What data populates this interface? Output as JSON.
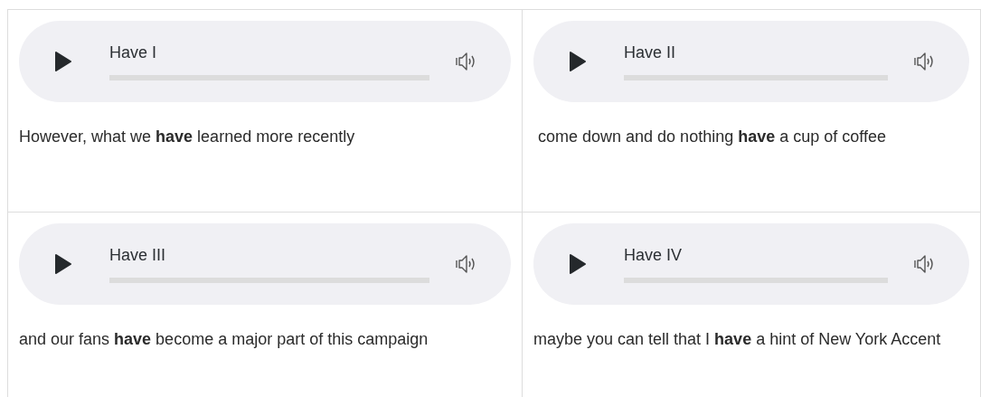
{
  "cards": [
    {
      "player": {
        "title": "Have I"
      },
      "sentence": "However, what we **have** learned more recently"
    },
    {
      "player": {
        "title": "Have II"
      },
      "sentence": " come down and do nothing **have** a cup of coffee"
    },
    {
      "player": {
        "title": "Have III"
      },
      "sentence": "and our fans **have** become a major part of this campaign"
    },
    {
      "player": {
        "title": "Have IV"
      },
      "sentence": "maybe you can tell that I **have** a hint of New York Accent"
    }
  ]
}
